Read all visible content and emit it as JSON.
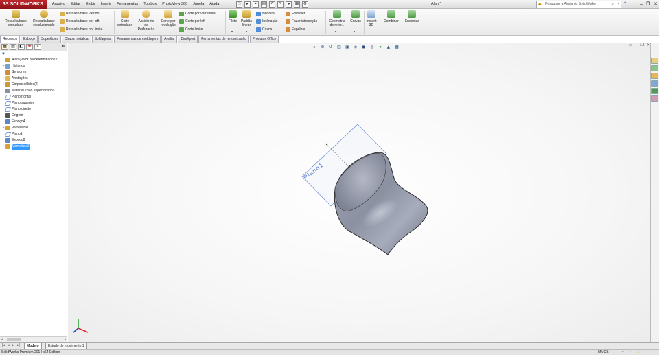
{
  "app": {
    "logo_prefix": "3S",
    "logo_text": "SOLIDWORKS",
    "doc_title": "Alan *",
    "help_search_placeholder": "Pesquisar a Ajuda do SolidWorks"
  },
  "menu": [
    "Arquivo",
    "Editar",
    "Exibir",
    "Inserir",
    "Ferramentas",
    "Toolbox",
    "PhotoView 360",
    "Janela",
    "Ajuda"
  ],
  "commands": {
    "extrude_boss": "Ressalto/base extrudado",
    "revolve_boss": "Ressalto/base revolucionado",
    "sweep_boss": "Ressalto/base varrido",
    "loft_boss": "Ressalto/base por loft",
    "boundary_boss": "Ressalto/base por limite",
    "extrude_cut": "Corte extrudado",
    "hole_wizard": "Assistente de Perfuração",
    "revolve_cut": "Corte por revolução",
    "sweep_cut": "Corte por varredura",
    "loft_cut": "Corte por loft",
    "boundary_cut": "Corte limite",
    "fillet": "Filete",
    "linear_pattern": "Padrão linear",
    "rib": "Nervura",
    "draft": "Inclinação",
    "shell": "Casca",
    "wrap": "Envolver",
    "intersect": "Fazer interseção",
    "mirror": "Espelhar",
    "ref_geometry": "Geometria de refer...",
    "curves": "Curvas",
    "instant3d": "Instant 3D",
    "combine": "Combinar",
    "indent": "Endentar"
  },
  "command_tabs": [
    "Recursos",
    "Esboço",
    "Superfícies",
    "Chapa metálica",
    "Soldagens",
    "Ferramentas de moldagem",
    "Avaliar",
    "DimXpert",
    "Ferramentas de renderização",
    "Produtos Office"
  ],
  "feature_tree": {
    "items": [
      {
        "label": "Alan  (Valor predeterminado<<",
        "icon": "part-icon",
        "expand": ""
      },
      {
        "label": "Histórico",
        "icon": "history-icon",
        "expand": "+"
      },
      {
        "label": "Sensores",
        "icon": "sensor-icon",
        "expand": ""
      },
      {
        "label": "Anotações",
        "icon": "annotation-icon",
        "expand": "+"
      },
      {
        "label": "Corpos sólidos(2)",
        "icon": "solid-bodies-icon",
        "expand": "+"
      },
      {
        "label": "Material <não especificado>",
        "icon": "material-icon",
        "expand": ""
      },
      {
        "label": "Plano frontal",
        "icon": "plane-icon",
        "expand": ""
      },
      {
        "label": "Plano superior",
        "icon": "plane-icon",
        "expand": ""
      },
      {
        "label": "Plano direito",
        "icon": "plane-icon",
        "expand": ""
      },
      {
        "label": "Origem",
        "icon": "origin-icon",
        "expand": ""
      },
      {
        "label": "Esboço4",
        "icon": "sketch-icon",
        "expand": ""
      },
      {
        "label": "Varredura1",
        "icon": "sweep-icon",
        "expand": "+"
      },
      {
        "label": "Plano1",
        "icon": "plane-icon",
        "expand": ""
      },
      {
        "label": "Esboço8",
        "icon": "sketch-icon",
        "expand": ""
      },
      {
        "label": "Varredura2",
        "icon": "sweep-icon",
        "expand": "+"
      }
    ],
    "selected_index": 14
  },
  "viewport": {
    "plane_label": "Plano1"
  },
  "bottom_tabs": [
    "Modelo",
    "Estudo de movimento 1"
  ],
  "status": {
    "text": "SolidWorks Premium 2014 x64 Edition",
    "units": "MMGS"
  },
  "colors": {
    "logo_red": "#b3212a",
    "selection_blue": "#3399ff",
    "part_gray": "#8f95a6",
    "plane_blue": "#4d79d6"
  }
}
